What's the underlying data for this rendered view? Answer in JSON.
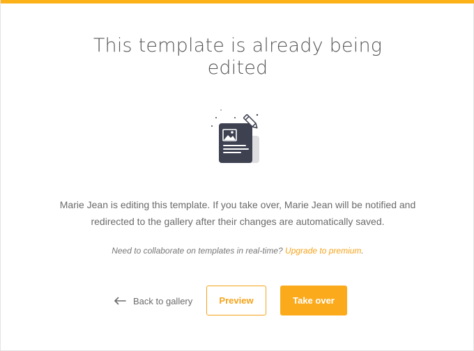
{
  "dialog": {
    "title_line1": "This template is already being",
    "title_line2": "edited",
    "message_line1": "Marie Jean is editing this template. If you take over, Marie Jean will be notified and",
    "message_line2": "redirected to the gallery after their changes are automatically saved.",
    "note_text": "Need to collaborate on templates in real-time?",
    "note_link": "Upgrade to premium",
    "note_suffix": ".",
    "illustration_icon": "document-edit-icon"
  },
  "actions": {
    "back_label": "Back to gallery",
    "back_icon": "arrow-left-icon",
    "preview_label": "Preview",
    "take_over_label": "Take over"
  },
  "colors": {
    "accent": "#fbb117",
    "document": "#3d4150",
    "text": "#6a6a6a"
  }
}
